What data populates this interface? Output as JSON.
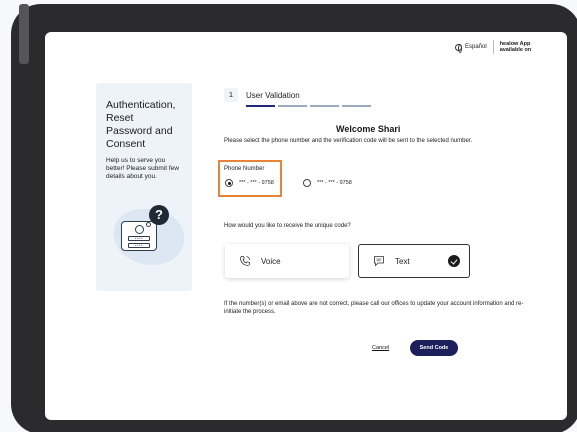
{
  "header": {
    "language_label": "Español",
    "healow_label_line1": "healow App",
    "healow_label_line2": "available on"
  },
  "left_panel": {
    "title": "Authentication, Reset Password and Consent",
    "description": "Help us to serve you better! Please submit few details about you.",
    "question_mark": "?",
    "password_mask": "****"
  },
  "stepper": {
    "step_number": "1",
    "step_label": "User Validation"
  },
  "main": {
    "welcome": "Welcome Shari",
    "instruction": "Please select the phone number and the verification code will be sent to the selected number.",
    "phone_number_label": "Phone Number",
    "phone_options": [
      {
        "value": "*** - *** - 9758",
        "selected": true
      },
      {
        "value": "*** - *** - 9758",
        "selected": false
      }
    ],
    "receive_question": "How would you like to receive the unique code?",
    "method_voice": "Voice",
    "method_text": "Text",
    "selected_method": "Text",
    "note": "If the number(s) or email above are not correct, please call our offices to update your account information and re-initiate the process."
  },
  "actions": {
    "cancel_label": "Cancel",
    "send_label": "Send Code"
  },
  "colors": {
    "primary_button": "#1c1f5c",
    "highlight_border": "#e8833a",
    "progress_active": "#202a78",
    "panel_background": "#eef3fa"
  }
}
